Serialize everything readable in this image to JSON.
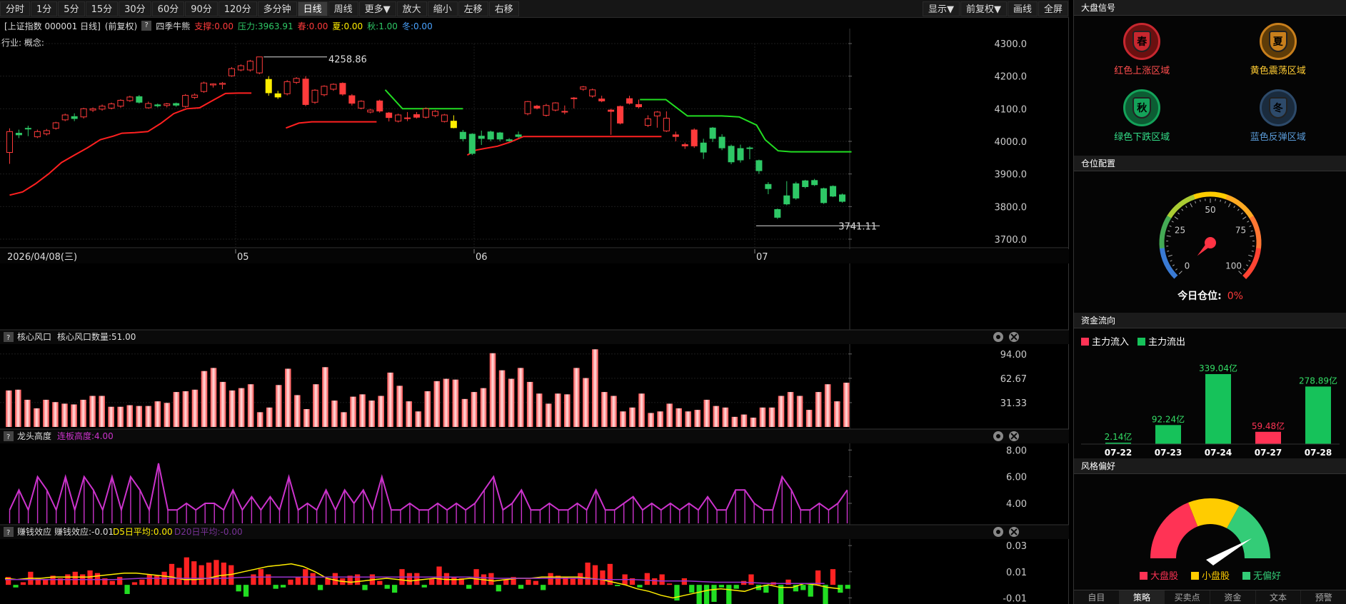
{
  "toolbar": {
    "periods": [
      "分时",
      "1分",
      "5分",
      "15分",
      "30分",
      "60分",
      "90分",
      "120分",
      "多分钟",
      "日线",
      "周线",
      "更多▼",
      "放大",
      "缩小",
      "左移",
      "右移"
    ],
    "active": "日线",
    "right": [
      "显示▼",
      "前复权▼",
      "画线",
      "全屏"
    ]
  },
  "info": {
    "title": "[上证指数 000001 日线]",
    "adj": "(前复权)",
    "q": "?",
    "indicator": "四季牛熊",
    "support": "支撑:0.00",
    "pressure": "压力:3963.91",
    "spring": "春:0.00",
    "summer": "夏:0.00",
    "autumn": "秋:1.00",
    "winter": "冬:0.00",
    "industry": "行业:",
    "concept": "概念:"
  },
  "colors": {
    "up": "#ff3b3b",
    "down": "#2ec866",
    "yellow": "#ffee00",
    "red_line": "#ff2020",
    "green_line": "#22dd22",
    "magenta": "#cc33cc",
    "purple": "#9933cc"
  },
  "price_chart": {
    "y_ticks": [
      "4300.0",
      "4200.0",
      "4100.0",
      "4000.0",
      "3900.0",
      "3800.0",
      "3700.0"
    ],
    "y_min": 3700,
    "y_max": 4300,
    "date_label": "2026/04/08(三)",
    "months": [
      "05",
      "06",
      "07"
    ],
    "high_label": "4258.86",
    "low_label": "3741.11",
    "candles": [
      [
        3966,
        4030,
        3931,
        4040,
        "up"
      ],
      [
        4025,
        4020,
        4010,
        4036,
        "down"
      ],
      [
        4038,
        4040,
        4016,
        4048,
        "down"
      ],
      [
        4014,
        4030,
        4010,
        4036,
        "up"
      ],
      [
        4023,
        4033,
        4018,
        4038,
        "up"
      ],
      [
        4040,
        4057,
        4036,
        4060,
        "up"
      ],
      [
        4066,
        4081,
        4062,
        4085,
        "up"
      ],
      [
        4076,
        4070,
        4062,
        4086,
        "down"
      ],
      [
        4075,
        4100,
        4070,
        4103,
        "up"
      ],
      [
        4096,
        4100,
        4090,
        4104,
        "up"
      ],
      [
        4099,
        4108,
        4094,
        4113,
        "up"
      ],
      [
        4102,
        4115,
        4098,
        4119,
        "up"
      ],
      [
        4108,
        4126,
        4103,
        4129,
        "up"
      ],
      [
        4125,
        4136,
        4121,
        4140,
        "up"
      ],
      [
        4137,
        4120,
        4116,
        4142,
        "down"
      ],
      [
        4103,
        4116,
        4100,
        4122,
        "up"
      ],
      [
        4112,
        4109,
        4104,
        4116,
        "down"
      ],
      [
        4110,
        4115,
        4104,
        4118,
        "up"
      ],
      [
        4116,
        4111,
        4106,
        4119,
        "down"
      ],
      [
        4107,
        4141,
        4103,
        4145,
        "up"
      ],
      [
        4135,
        4142,
        4130,
        4147,
        "up"
      ],
      [
        4153,
        4179,
        4149,
        4183,
        "up"
      ],
      [
        4173,
        4176,
        4165,
        4178,
        "up"
      ],
      [
        4175,
        4178,
        4160,
        4182,
        "up"
      ],
      [
        4201,
        4223,
        4198,
        4228,
        "up"
      ],
      [
        4219,
        4232,
        4215,
        4236,
        "up"
      ],
      [
        4219,
        4246,
        4214,
        4250,
        "up"
      ],
      [
        4210,
        4259,
        4206,
        4259,
        "up"
      ],
      [
        4190,
        4149,
        4140,
        4200,
        "yellow"
      ],
      [
        4146,
        4136,
        4130,
        4155,
        "yellow"
      ],
      [
        4146,
        4183,
        4141,
        4188,
        "up"
      ],
      [
        4181,
        4193,
        4176,
        4197,
        "up"
      ],
      [
        4191,
        4113,
        4108,
        4200,
        "up"
      ],
      [
        4120,
        4157,
        4115,
        4160,
        "up"
      ],
      [
        4143,
        4169,
        4138,
        4172,
        "up"
      ],
      [
        4160,
        4175,
        4155,
        4178,
        "up"
      ],
      [
        4178,
        4145,
        4140,
        4181,
        "up"
      ],
      [
        4140,
        4117,
        4110,
        4145,
        "up"
      ],
      [
        4102,
        4123,
        4098,
        4126,
        "up"
      ],
      [
        4090,
        4096,
        4086,
        4100,
        "up"
      ],
      [
        4124,
        4093,
        4088,
        4128,
        "up"
      ],
      [
        4087,
        4073,
        4061,
        4090,
        "up"
      ],
      [
        4062,
        4081,
        4058,
        4085,
        "up"
      ],
      [
        4072,
        4071,
        4062,
        4090,
        "up"
      ],
      [
        4082,
        4074,
        4070,
        4090,
        "up"
      ],
      [
        4074,
        4100,
        4070,
        4104,
        "up"
      ],
      [
        4079,
        4092,
        4074,
        4096,
        "up"
      ],
      [
        4061,
        4081,
        4058,
        4084,
        "up"
      ],
      [
        4042,
        4062,
        4040,
        4080,
        "yellow"
      ],
      [
        4028,
        4008,
        4000,
        4035,
        "down"
      ],
      [
        4022,
        3963,
        3958,
        4025,
        "down"
      ],
      [
        4009,
        4016,
        3989,
        4033,
        "down"
      ],
      [
        4007,
        4029,
        4000,
        4033,
        "down"
      ],
      [
        4007,
        4026,
        4000,
        4029,
        "down"
      ],
      [
        4002,
        4005,
        3999,
        4010,
        "down"
      ],
      [
        4015,
        4020,
        4010,
        4030,
        "down"
      ],
      [
        4085,
        4122,
        4080,
        4124,
        "up"
      ],
      [
        4108,
        4102,
        4098,
        4112,
        "up"
      ],
      [
        4080,
        4110,
        4076,
        4115,
        "up"
      ],
      [
        4096,
        4118,
        4092,
        4120,
        "up"
      ],
      [
        4092,
        4090,
        4083,
        4110,
        "up"
      ],
      [
        4133,
        4133,
        4101,
        4136,
        "up"
      ],
      [
        4160,
        4167,
        4155,
        4170,
        "up"
      ],
      [
        4139,
        4158,
        4134,
        4162,
        "up"
      ],
      [
        4130,
        4124,
        4120,
        4140,
        "up"
      ],
      [
        4096,
        4092,
        4020,
        4100,
        "up"
      ],
      [
        4107,
        4056,
        4052,
        4110,
        "up"
      ],
      [
        4131,
        4117,
        4113,
        4140,
        "up"
      ],
      [
        4113,
        4106,
        4101,
        4128,
        "up"
      ],
      [
        4049,
        4069,
        4044,
        4080,
        "up"
      ],
      [
        4078,
        4090,
        4042,
        4093,
        "up"
      ],
      [
        4032,
        4071,
        4029,
        4092,
        "up"
      ],
      [
        4020,
        4015,
        4000,
        4030,
        "up"
      ],
      [
        3990,
        3986,
        3977,
        3996,
        "up"
      ],
      [
        4035,
        3986,
        3980,
        4040,
        "up"
      ],
      [
        3967,
        3995,
        3946,
        4008,
        "down"
      ],
      [
        4009,
        4041,
        3998,
        4044,
        "down"
      ],
      [
        3980,
        4013,
        3973,
        4022,
        "down"
      ],
      [
        3937,
        3985,
        3930,
        3990,
        "down"
      ],
      [
        3943,
        3978,
        3935,
        3990,
        "down"
      ],
      [
        3980,
        3980,
        3945,
        3985,
        "down"
      ],
      [
        3910,
        3941,
        3900,
        3944,
        "down"
      ],
      [
        3855,
        3868,
        3838,
        3875,
        "down"
      ],
      [
        3767,
        3791,
        3762,
        3794,
        "down"
      ],
      [
        3833,
        3808,
        3804,
        3878,
        "down"
      ],
      [
        3826,
        3870,
        3821,
        3876,
        "down"
      ],
      [
        3861,
        3879,
        3856,
        3882,
        "down"
      ],
      [
        3880,
        3867,
        3863,
        3885,
        "down"
      ],
      [
        3812,
        3855,
        3808,
        3858,
        "down"
      ],
      [
        3832,
        3862,
        3829,
        3865,
        "down"
      ],
      [
        3816,
        3836,
        3812,
        3840,
        "down"
      ]
    ],
    "red_line": [
      [
        0,
        3835
      ],
      [
        3,
        3845
      ],
      [
        6,
        3870
      ],
      [
        9,
        3900
      ],
      [
        12,
        3935
      ],
      [
        15,
        3958
      ],
      [
        18,
        3980
      ],
      [
        21,
        4005
      ],
      [
        24,
        4016
      ],
      [
        26,
        4025
      ],
      [
        29,
        4027
      ],
      [
        32,
        4030
      ],
      [
        35,
        4055
      ],
      [
        38,
        4085
      ],
      [
        41,
        4100
      ],
      [
        44,
        4103
      ],
      [
        47,
        4125
      ],
      [
        50,
        4147
      ],
      [
        53,
        4148
      ],
      [
        56,
        4148
      ]
    ],
    "red_line2": [
      [
        64,
        4041
      ],
      [
        67,
        4056
      ],
      [
        70,
        4060
      ],
      [
        73,
        4060
      ],
      [
        76,
        4060
      ],
      [
        79,
        4060
      ],
      [
        82,
        4060
      ],
      [
        85,
        4060
      ]
    ],
    "red_line3": [
      [
        106,
        3958
      ],
      [
        108,
        3973
      ],
      [
        110,
        3978
      ],
      [
        113,
        3985
      ],
      [
        116,
        3998
      ],
      [
        119,
        4015
      ],
      [
        124,
        4015
      ],
      [
        130,
        4015
      ],
      [
        136,
        4015
      ],
      [
        141,
        4015
      ],
      [
        146,
        4015
      ],
      [
        151,
        4015
      ]
    ],
    "green_line": [
      [
        87,
        4158
      ],
      [
        91,
        4100
      ],
      [
        95,
        4100
      ],
      [
        99,
        4100
      ],
      [
        105,
        4100
      ]
    ],
    "green_line2": [
      [
        146,
        4128
      ],
      [
        149,
        4128
      ],
      [
        152,
        4128
      ],
      [
        154,
        4108
      ],
      [
        157,
        4078
      ],
      [
        161,
        4078
      ],
      [
        165,
        4078
      ],
      [
        169,
        4075
      ],
      [
        173,
        4050
      ],
      [
        175,
        4005
      ],
      [
        178,
        3971
      ],
      [
        181,
        3968
      ],
      [
        185,
        3968
      ],
      [
        190,
        3968
      ],
      [
        195,
        3968
      ]
    ]
  },
  "vol": {
    "label": "核心风口",
    "label2": "核心风口数量:51.00",
    "ticks": [
      "94.00",
      "62.67",
      "31.33"
    ],
    "y_max": 103,
    "values": [
      47,
      48,
      35,
      24,
      35,
      32,
      30,
      29,
      35,
      40,
      40,
      26,
      26,
      28,
      27,
      27,
      33,
      31,
      45,
      46,
      48,
      72,
      76,
      58,
      47,
      50,
      55,
      19,
      25,
      54,
      75,
      41,
      23,
      55,
      77,
      34,
      19,
      39,
      42,
      34,
      40,
      70,
      53,
      33,
      20,
      46,
      59,
      62,
      61,
      36,
      45,
      50,
      95,
      73,
      62,
      76,
      58,
      43,
      30,
      43,
      42,
      76,
      63,
      100,
      45,
      40,
      20,
      25,
      43,
      18,
      20,
      30,
      24,
      20,
      22,
      35,
      27,
      25,
      13,
      16,
      12,
      25,
      25,
      40,
      45,
      40,
      22,
      45,
      55,
      33,
      57
    ]
  },
  "dragon": {
    "label": "龙头高度",
    "label2": "连板高度:4.00",
    "ticks": [
      "8.00",
      "6.00",
      "4.00"
    ],
    "y_min": 2.5,
    "y_max": 8.5,
    "values": [
      3.5,
      5,
      3.5,
      6,
      5,
      3.5,
      6,
      3.5,
      6,
      5,
      3.5,
      6,
      3.5,
      6,
      5,
      3.5,
      7,
      3.5,
      3.5,
      4,
      3.5,
      4,
      4,
      3.5,
      5,
      3.5,
      4.5,
      3.5,
      4.5,
      3.5,
      6,
      3.5,
      4,
      3.5,
      5,
      3.5,
      5,
      4,
      5,
      3.5,
      6,
      3.5,
      3.5,
      4,
      3.5,
      3.5,
      4,
      3.5,
      4,
      3.5,
      4,
      5,
      6,
      3.5,
      4,
      5,
      3.5,
      3.5,
      4,
      3.5,
      3.5,
      4,
      3.5,
      5,
      3.5,
      3.5,
      4,
      4.5,
      3.5,
      4,
      3.5,
      4,
      3.5,
      4,
      3.5,
      4.5,
      3.5,
      3.5,
      5,
      5,
      4,
      3.5,
      3.5,
      6,
      5,
      3.5,
      3.5,
      4,
      3.5,
      4,
      5
    ]
  },
  "profit": {
    "label": "赚钱效应",
    "label2": "赚钱效应:-0.01",
    "d5": "D5日平均:0.00",
    "d20": "D20日平均:-0.00",
    "ticks": [
      "0.03",
      "0.01",
      "-0.01"
    ],
    "y_min": -0.025,
    "y_max": 0.035,
    "bars": [
      0.006,
      -0.002,
      0.002,
      0.01,
      0.005,
      0.004,
      0.007,
      0.005,
      0.008,
      0.01,
      0.008,
      0.011,
      0.009,
      0.005,
      0.003,
      0.006,
      -0.007,
      0.002,
      0.004,
      0.008,
      0.007,
      0.01,
      0.016,
      0.013,
      0.021,
      0.018,
      0.015,
      0.017,
      0.019,
      0.017,
      0.015,
      -0.005,
      -0.009,
      0.008,
      0.012,
      0.008,
      -0.003,
      -0.002,
      0.004,
      0.006,
      0.012,
      0.009,
      -0.004,
      0.005,
      0.009,
      0.005,
      0.007,
      0.008,
      -0.004,
      0.008,
      0.003,
      -0.003,
      -0.006,
      0.012,
      0.009,
      0.009,
      -0.002,
      0.005,
      0.014,
      0.009,
      0.006,
      0.005,
      -0.003,
      0.012,
      0.008,
      0.009,
      -0.005,
      0.004,
      0.006,
      -0.003,
      0.004,
      0.003,
      -0.004,
      0.009,
      0.007,
      0.006,
      0.005,
      0.009,
      0.017,
      0.015,
      0.011,
      0.016,
      -0.001,
      0.008,
      0.005,
      -0.002,
      0.009,
      0.005,
      0.008,
      0.001,
      -0.012,
      0.005,
      -0.006,
      -0.015,
      -0.016,
      -0.013,
      -0.002,
      -0.015,
      -0.003,
      0.003,
      0.008,
      -0.004,
      -0.006,
      0.002,
      -0.018,
      0.004,
      -0.005,
      -0.004,
      -0.009,
      0.011,
      -0.018,
      0.012,
      -0.006,
      -0.003
    ],
    "d5_line": [
      0.005,
      0.004,
      0.005,
      0.005,
      0.006,
      0.006,
      0.006,
      0.006,
      0.007,
      0.008,
      0.009,
      0.009,
      0.008,
      0.007,
      0.006,
      0.004,
      0.004,
      0.005,
      0.007,
      0.008,
      0.01,
      0.012,
      0.014,
      0.015,
      0.016,
      0.014,
      0.01,
      0.005,
      0.003,
      0.002,
      0.003,
      0.004,
      0.005,
      0.004,
      0.003,
      0.004,
      0.005,
      0.004,
      0.004,
      0.005,
      0.004,
      0.003,
      0.004,
      0.005,
      0.005,
      0.006,
      0.006,
      0.006,
      0.006,
      0.005,
      0.004,
      0.002,
      0.0,
      -0.003,
      -0.005,
      -0.008,
      -0.01,
      -0.008,
      -0.006,
      -0.004,
      -0.003,
      -0.004,
      -0.005,
      -0.002,
      0.0,
      -0.002,
      -0.002,
      0.001,
      0.0,
      -0.002,
      -0.003
    ],
    "d20_line": [
      0.004,
      0.004,
      0.004,
      0.004,
      0.004,
      0.005,
      0.005,
      0.005,
      0.005,
      0.006,
      0.006,
      0.006,
      0.006,
      0.006,
      0.006,
      0.006,
      0.006,
      0.006,
      0.005,
      0.005,
      0.005,
      0.005,
      0.004,
      0.004,
      0.003,
      0.003,
      0.002,
      0.002,
      0.001,
      0.001,
      0.001
    ]
  },
  "side": {
    "signal_title": "大盘信号",
    "signals": [
      {
        "ch": "春",
        "label": "红色上涨区域",
        "color": "#c8272f",
        "ring": "#6a1010",
        "text": "#ff4d4d"
      },
      {
        "ch": "夏",
        "label": "黄色震荡区域",
        "color": "#c87f1c",
        "ring": "#5e3c08",
        "text": "#ffcc33"
      },
      {
        "ch": "秋",
        "label": "绿色下跌区域",
        "color": "#14a35a",
        "ring": "#0c5c33",
        "text": "#33dd88"
      },
      {
        "ch": "冬",
        "label": "蓝色反弹区域",
        "color": "#2d4a6a",
        "ring": "#1a2b3d",
        "text": "#5a9bd8"
      }
    ],
    "position_title": "仓位配置",
    "gauge": {
      "ticks": [
        "0",
        "25",
        "50",
        "75",
        "100"
      ],
      "label": "今日仓位:",
      "value": "0%",
      "pct": 0
    },
    "flow_title": "资金流向",
    "flow_legend_in": "主力流入",
    "flow_legend_out": "主力流出",
    "flow": [
      {
        "date": "07-22",
        "value": "2.14亿",
        "amount": 2.14,
        "dir": "out"
      },
      {
        "date": "07-23",
        "value": "92.24亿",
        "amount": 92.24,
        "dir": "out"
      },
      {
        "date": "07-24",
        "value": "339.04亿",
        "amount": 339.04,
        "dir": "out"
      },
      {
        "date": "07-27",
        "value": "59.48亿",
        "amount": 59.48,
        "dir": "in"
      },
      {
        "date": "07-28",
        "value": "278.89亿",
        "amount": 278.89,
        "dir": "out"
      }
    ],
    "style_title": "风格偏好",
    "style_legend": [
      {
        "label": "大盘股",
        "color": "#ff3355"
      },
      {
        "label": "小盘股",
        "color": "#ffcc00"
      },
      {
        "label": "无偏好",
        "color": "#33cc77"
      }
    ],
    "tabs": [
      "自目",
      "策略",
      "买卖点",
      "资金",
      "文本",
      "预警"
    ]
  }
}
